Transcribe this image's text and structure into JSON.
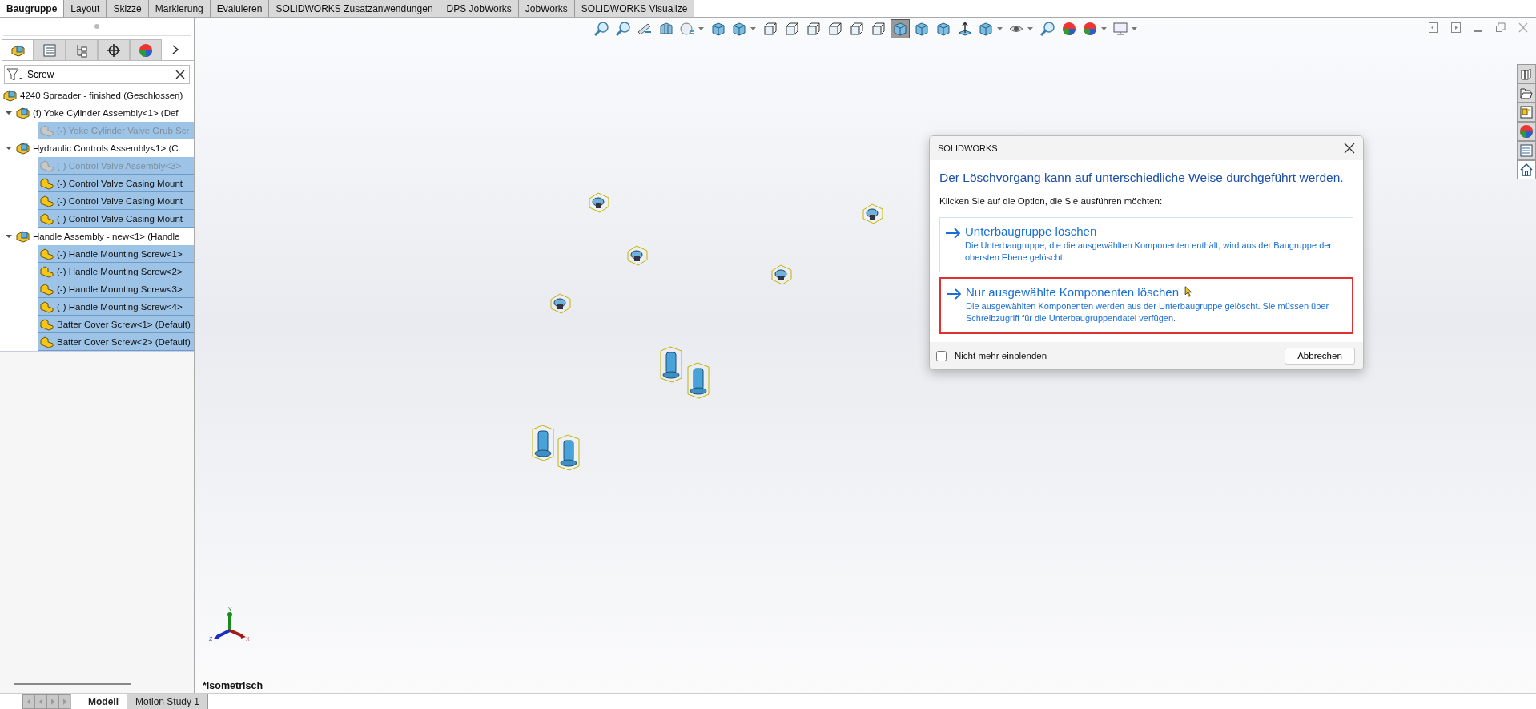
{
  "ribbon_tabs": [
    {
      "label": "Baugruppe",
      "selected": true
    },
    {
      "label": "Layout",
      "selected": false
    },
    {
      "label": "Skizze",
      "selected": false
    },
    {
      "label": "Markierung",
      "selected": false
    },
    {
      "label": "Evaluieren",
      "selected": false
    },
    {
      "label": "SOLIDWORKS Zusatzanwendungen",
      "selected": false
    },
    {
      "label": "DPS JobWorks",
      "selected": false
    },
    {
      "label": "JobWorks",
      "selected": false
    },
    {
      "label": "SOLIDWORKS Visualize",
      "selected": false
    }
  ],
  "panel_tabs": [
    {
      "kind": "assembly",
      "selected": true
    },
    {
      "kind": "list",
      "selected": false
    },
    {
      "kind": "config",
      "selected": false
    },
    {
      "kind": "target",
      "selected": false
    },
    {
      "kind": "appearance",
      "selected": false
    }
  ],
  "filter": {
    "value": "Screw"
  },
  "tree": {
    "label": "4240 Spreader - finished (Geschlossen)",
    "kind": "assembly",
    "selected": false,
    "disabled": false,
    "children": [
      {
        "label": "(f) Yoke Cylinder Assembly<1> (Def",
        "kind": "assembly",
        "expanded": true,
        "selected": false,
        "disabled": false,
        "children": [
          {
            "label": "(-) Yoke Cylinder Valve Grub Scr",
            "kind": "part",
            "selected": true,
            "disabled": true
          }
        ]
      },
      {
        "label": "Hydraulic Controls Assembly<1> (C",
        "kind": "assembly",
        "expanded": true,
        "selected": false,
        "disabled": false,
        "children": [
          {
            "label": "(-) Control Valve Assembly<3>",
            "kind": "part",
            "selected": true,
            "disabled": true
          },
          {
            "label": "(-) Control Valve Casing Mount",
            "kind": "part",
            "selected": true,
            "disabled": false
          },
          {
            "label": "(-) Control Valve Casing Mount",
            "kind": "part",
            "selected": true,
            "disabled": false
          },
          {
            "label": "(-) Control Valve Casing Mount",
            "kind": "part",
            "selected": true,
            "disabled": false
          }
        ]
      },
      {
        "label": "Handle Assembly - new<1> (Handle",
        "kind": "assembly",
        "expanded": true,
        "selected": false,
        "disabled": false,
        "children": [
          {
            "label": "(-) Handle Mounting Screw<1>",
            "kind": "part",
            "selected": true,
            "disabled": false
          },
          {
            "label": "(-) Handle Mounting Screw<2>",
            "kind": "part",
            "selected": true,
            "disabled": false
          },
          {
            "label": "(-) Handle Mounting Screw<3>",
            "kind": "part",
            "selected": true,
            "disabled": false
          },
          {
            "label": "(-) Handle Mounting Screw<4>",
            "kind": "part",
            "selected": true,
            "disabled": false
          },
          {
            "label": "Batter Cover Screw<1> (Default)",
            "kind": "part",
            "selected": true,
            "disabled": false
          },
          {
            "label": "Batter Cover Screw<2> (Default)",
            "kind": "part",
            "selected": true,
            "disabled": false
          }
        ]
      }
    ]
  },
  "view_toolbar": [
    {
      "kind": "magnifier",
      "selected": false,
      "dropdown": false
    },
    {
      "kind": "magnifier",
      "selected": false,
      "dropdown": false
    },
    {
      "kind": "telescope",
      "selected": false,
      "dropdown": false
    },
    {
      "kind": "section",
      "selected": false,
      "dropdown": false
    },
    {
      "kind": "sphere",
      "selected": false,
      "dropdown": true
    },
    {
      "kind": "shaded",
      "selected": false,
      "dropdown": false
    },
    {
      "kind": "shaded",
      "selected": false,
      "dropdown": true
    },
    {
      "kind": "wireframe",
      "selected": false,
      "dropdown": false
    },
    {
      "kind": "wireframe",
      "selected": false,
      "dropdown": false
    },
    {
      "kind": "wireframe",
      "selected": false,
      "dropdown": false
    },
    {
      "kind": "wireframe",
      "selected": false,
      "dropdown": false
    },
    {
      "kind": "wireframe",
      "selected": false,
      "dropdown": false
    },
    {
      "kind": "wireframe",
      "selected": false,
      "dropdown": false
    },
    {
      "kind": "shaded",
      "selected": true,
      "dropdown": false
    },
    {
      "kind": "shaded",
      "selected": false,
      "dropdown": false
    },
    {
      "kind": "shaded",
      "selected": false,
      "dropdown": false
    },
    {
      "kind": "normal",
      "selected": false,
      "dropdown": false
    },
    {
      "kind": "shaded",
      "selected": false,
      "dropdown": true
    },
    {
      "kind": "eye",
      "selected": false,
      "dropdown": true
    },
    {
      "kind": "magnifier",
      "selected": false,
      "dropdown": false
    },
    {
      "kind": "palette",
      "selected": false,
      "dropdown": false
    },
    {
      "kind": "palette",
      "selected": false,
      "dropdown": true
    },
    {
      "kind": "monitor",
      "selected": false,
      "dropdown": true
    }
  ],
  "task_pane": [
    {
      "kind": "library",
      "selected": false
    },
    {
      "kind": "folder",
      "selected": false
    },
    {
      "kind": "palette",
      "selected": false
    },
    {
      "kind": "appearance",
      "selected": false
    },
    {
      "kind": "list",
      "selected": false
    },
    {
      "kind": "home",
      "selected": true
    }
  ],
  "dialog": {
    "title": "SOLIDWORKS",
    "heading": "Der Löschvorgang kann auf unterschiedliche Weise durchgeführt werden.",
    "instruction": "Klicken Sie auf die Option, die Sie ausführen möchten:",
    "options": [
      {
        "title": "Unterbaugruppe löschen",
        "description": "Die Unterbaugruppe, die die ausgewählten Komponenten enthält, wird aus der Baugruppe der obersten Ebene gelöscht.",
        "outlined": false
      },
      {
        "title": "Nur ausgewählte Komponenten löschen",
        "description": "Die ausgewählten Komponenten werden aus der Unterbaugruppe gelöscht. Sie müssen über Schreibzugriff für die Unterbaugruppendatei verfügen.",
        "outlined": true
      }
    ],
    "checkbox": {
      "label": "Nicht mehr einblenden",
      "checked": false
    },
    "cancel_button": "Abbrechen"
  },
  "triad": {
    "x": "X",
    "y": "Y",
    "z": "Z"
  },
  "view_label": "*Isometrisch",
  "bottom_tabs": [
    {
      "label": "Modell",
      "selected": true
    },
    {
      "label": "Motion Study 1",
      "selected": false
    }
  ]
}
